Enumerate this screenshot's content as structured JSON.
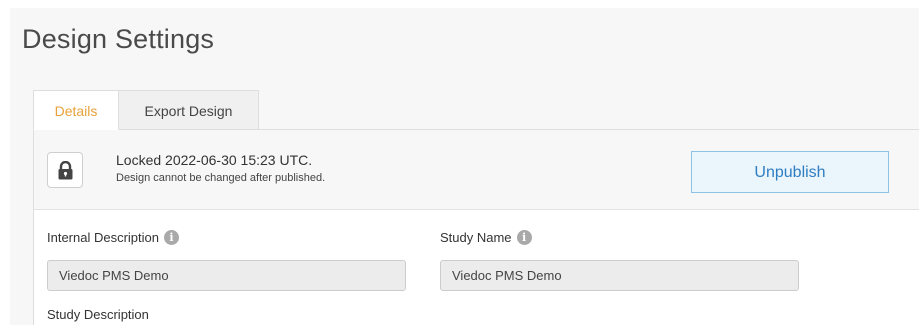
{
  "page": {
    "title": "Design Settings"
  },
  "tabs": [
    {
      "label": "Details",
      "active": true
    },
    {
      "label": "Export Design",
      "active": false
    }
  ],
  "lock": {
    "icon": "lock-icon",
    "title": "Locked 2022-06-30 15:23 UTC.",
    "subtitle": "Design cannot be changed after published.",
    "button_label": "Unpublish"
  },
  "fields": {
    "internal_description": {
      "label": "Internal Description",
      "value": "Viedoc PMS Demo",
      "info_icon": "info-icon"
    },
    "study_name": {
      "label": "Study Name",
      "value": "Viedoc PMS Demo",
      "info_icon": "info-icon"
    },
    "study_description": {
      "label": "Study Description"
    }
  },
  "colors": {
    "accent_orange": "#e8a23a",
    "button_blue": "#2f7ec2",
    "button_bg": "#eaf5fc"
  }
}
